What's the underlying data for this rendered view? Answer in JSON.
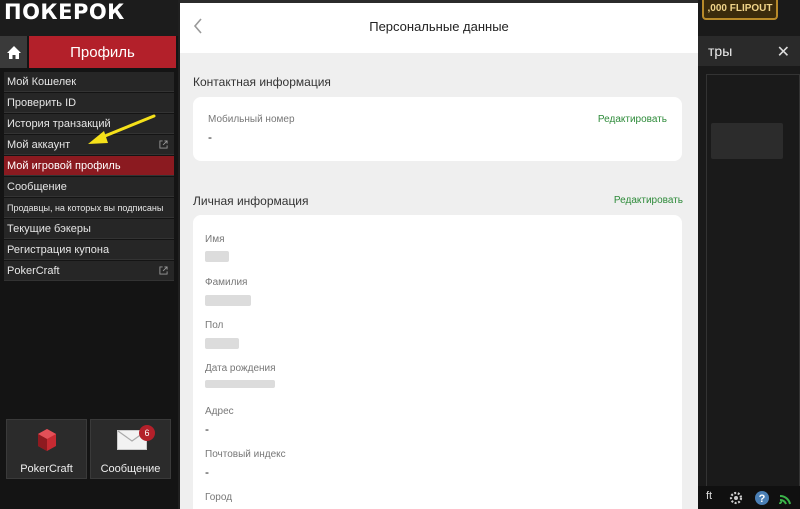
{
  "logo": {
    "text": "ПОКЕРОК"
  },
  "nav": {
    "profile_label": "Профиль"
  },
  "menu": [
    {
      "label": "Мой Кошелек",
      "external": false,
      "active": false,
      "small": false
    },
    {
      "label": "Проверить ID",
      "external": false,
      "active": false,
      "small": false
    },
    {
      "label": "История транзакций",
      "external": false,
      "active": false,
      "small": false
    },
    {
      "label": "Мой аккаунт",
      "external": true,
      "active": false,
      "small": false
    },
    {
      "label": "Мой игровой профиль",
      "external": false,
      "active": true,
      "small": false
    },
    {
      "label": "Сообщение",
      "external": false,
      "active": false,
      "small": false
    },
    {
      "label": "Продавцы, на которых вы подписаны",
      "external": false,
      "active": false,
      "small": true
    },
    {
      "label": "Текущие бэкеры",
      "external": false,
      "active": false,
      "small": false
    },
    {
      "label": "Регистрация купона",
      "external": false,
      "active": false,
      "small": false
    },
    {
      "label": "PokerCraft",
      "external": true,
      "active": false,
      "small": false
    }
  ],
  "tiles": {
    "pokercraft_label": "PokerCraft",
    "message_label": "Сообщение",
    "message_badge": "6"
  },
  "modal": {
    "title": "Персональные данные",
    "contact_title": "Контактная информация",
    "mobile_label": "Мобильный номер",
    "mobile_value": "-",
    "edit_label": "Редактировать",
    "personal_title": "Личная информация",
    "personal_edit_label": "Редактировать",
    "fields": {
      "first_name": "Имя",
      "last_name": "Фамилия",
      "gender": "Пол",
      "birth_date": "Дата рождения",
      "address": "Адрес",
      "address_value": "-",
      "postal_code": "Почтовый индекс",
      "postal_value": "-",
      "city": "Город"
    }
  },
  "right": {
    "flipout": ",000 FLIPOUT",
    "filter_text": "тры",
    "close": "✕",
    "bottom_text": "ft"
  },
  "colors": {
    "accent_red": "#b3202a",
    "active_red": "#8b1a20",
    "edit_green": "#2e8b3a",
    "arrow_yellow": "#f5e11a"
  }
}
